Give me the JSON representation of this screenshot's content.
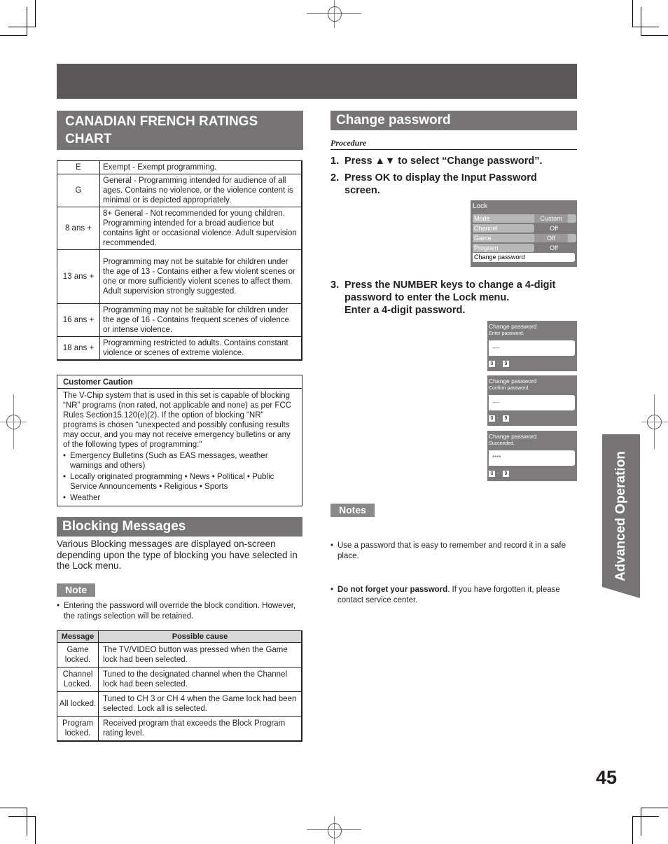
{
  "ratings_section": {
    "title": "CANADIAN FRENCH RATINGS CHART",
    "rows": [
      {
        "code": "E",
        "desc": "Exempt - Exempt programming."
      },
      {
        "code": "G",
        "desc": "General - Programming intended for audience of all ages. Contains no violence, or the violence content is minimal or is depicted appropriately."
      },
      {
        "code": "8 ans +",
        "desc": "8+ General - Not recommended for young children. Programming intended for a broad audience but contains light or occasional violence. Adult supervision recommended."
      },
      {
        "code": "13 ans +",
        "desc": "Programming may not be suitable for children under the age of 13 - Contains either a few violent scenes or one or more sufficiently violent scenes to affect them. Adult supervision strongly suggested."
      },
      {
        "code": "16 ans +",
        "desc": "Programming may not be suitable for children under the age of 16 - Contains frequent scenes of violence or intense violence."
      },
      {
        "code": "18 ans +",
        "desc": "Programming restricted to adults. Contains constant violence or scenes of extreme violence."
      }
    ]
  },
  "caution": {
    "title": "Customer Caution",
    "body": "The V-Chip system that is used in this set is capable of blocking “NR” programs (non rated, not applicable and none) as per FCC Rules Section15.120(e)(2). If the option of blocking “NR” programs is chosen “unexpected and possibly confusing results may occur, and you may not receive emergency bulletins or any of the following types of programming:\"",
    "bullets": [
      "Emergency Bulletins (Such as EAS messages, weather warnings and others)",
      "Locally originated programming • News • Political • Public Service Announcements • Religious • Sports",
      "Weather"
    ]
  },
  "blocking": {
    "title": "Blocking Messages",
    "intro": "Various Blocking messages are displayed on-screen depending upon the type of blocking you have selected in the Lock menu.",
    "note_label": "Note",
    "note": "Entering the password will override the block condition. However, the ratings selection will be retained.",
    "table": {
      "headers": [
        "Message",
        "Possible cause"
      ],
      "rows": [
        {
          "message": "Game locked.",
          "cause": "The TV/VIDEO button was pressed when the Game lock had been selected."
        },
        {
          "message": "Channel Locked.",
          "cause": "Tuned to the designated channel when the Channel lock had been selected."
        },
        {
          "message": "All locked.",
          "cause": "Tuned to CH 3 or CH 4 when the Game lock had been selected. Lock all is selected."
        },
        {
          "message": "Program locked.",
          "cause": "Received program that exceeds the Block Program rating level."
        }
      ]
    }
  },
  "change_password": {
    "title": "Change password",
    "procedure_label": "Procedure",
    "steps": [
      {
        "num": "1.",
        "text": "Press ▲▼ to select “Change password”."
      },
      {
        "num": "2.",
        "text": "Press OK to display the Input Password screen."
      },
      {
        "num": "3.",
        "text": "Press the NUMBER keys to change a 4-digit password to enter the Lock menu.",
        "text2": "Enter a 4-digit password."
      }
    ],
    "lock_menu": {
      "title": "Lock",
      "items": [
        {
          "label": "Mode",
          "value": "Custom"
        },
        {
          "label": "Channel",
          "value": "Off"
        },
        {
          "label": "Game",
          "value": "Off"
        },
        {
          "label": "Program",
          "value": "Off"
        }
      ],
      "selected": "Change password"
    },
    "screens": [
      {
        "title": "Change password",
        "subtitle": "Enter password.",
        "value": "----",
        "key_from": "0",
        "key_sep": "-",
        "key_to": "9"
      },
      {
        "title": "Change password",
        "subtitle": "Confirm password.",
        "value": "----",
        "key_from": "0",
        "key_sep": "-",
        "key_to": "9"
      },
      {
        "title": "Change password",
        "subtitle": "Succeeded.",
        "value": "****",
        "key_from": "0",
        "key_sep": "-",
        "key_to": "9"
      }
    ],
    "notes_label": "Notes",
    "notes": [
      {
        "bold": "",
        "text": "Use a password that is easy to remember and record it in a safe place."
      },
      {
        "bold": "Do not forget your password",
        "text": ". If you have forgotten it, please contact service center."
      }
    ]
  },
  "side_tab": "Advanced Operation",
  "page_number": "45",
  "colors": {
    "band": "#5a5859",
    "section_header": "#767475",
    "note_tag": "#8a8889",
    "osd_bg": "#7d7b7c"
  }
}
